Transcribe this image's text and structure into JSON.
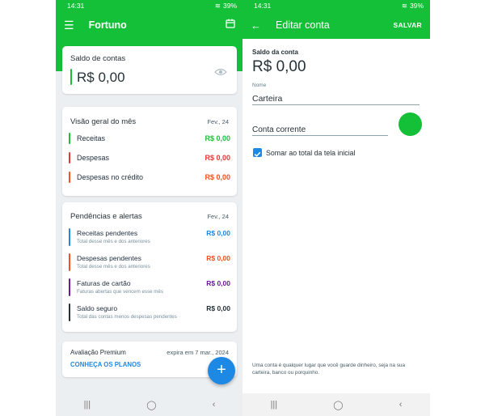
{
  "status": {
    "time": "14:31",
    "battery": "39%"
  },
  "left": {
    "app_title": "Fortuno",
    "balance": {
      "label": "Saldo de contas",
      "value": "R$ 0,00"
    },
    "overview": {
      "title": "Visão geral do mês",
      "period": "Fev., 24",
      "rows": [
        {
          "label": "Receitas",
          "value": "R$ 0,00",
          "color": "#1fbf3a"
        },
        {
          "label": "Despesas",
          "value": "R$ 0,00",
          "color": "#e53935"
        },
        {
          "label": "Despesas no crédito",
          "value": "R$ 0,00",
          "color": "#f4511e"
        }
      ]
    },
    "pending": {
      "title": "Pendências e alertas",
      "period": "Fev., 24",
      "rows": [
        {
          "label": "Receitas pendentes",
          "sub": "Total desse mês e dos anteriores",
          "value": "R$ 0,00",
          "color": "#1e88e5"
        },
        {
          "label": "Despesas pendentes",
          "sub": "Total desse mês e dos anteriores",
          "value": "R$ 0,00",
          "color": "#f4511e"
        },
        {
          "label": "Faturas de cartão",
          "sub": "Faturas abertas que vencem esse mês",
          "value": "R$ 0,00",
          "color": "#6a1b9a"
        },
        {
          "label": "Saldo seguro",
          "sub": "Total das contas menos despesas pendentes",
          "value": "R$ 0,00",
          "color": "#263238"
        }
      ]
    },
    "premium": {
      "title": "Avaliação Premium",
      "expires": "expira em 7 mar., 2024",
      "link": "CONHEÇA OS PLANOS"
    },
    "fab": "+"
  },
  "right": {
    "title": "Editar conta",
    "save": "SALVAR",
    "balance_label": "Saldo da conta",
    "balance_value": "R$ 0,00",
    "name_label": "Nome",
    "name_value": "Carteira",
    "type_value": "Conta corrente",
    "account_color": "#13c038",
    "checkbox_label": "Somar ao total da tela inicial",
    "footer": "Uma conta é qualquer lugar que você guarde dinheiro, seja na sua carteira, banco ou porquinho."
  }
}
